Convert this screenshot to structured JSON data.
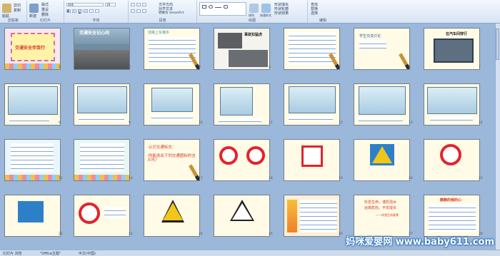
{
  "ribbon": {
    "groups": [
      {
        "id": "clipboard",
        "label": "剪贴板",
        "buttons": [
          "剪切",
          "复制",
          "粘贴"
        ]
      },
      {
        "id": "slides",
        "label": "幻灯片",
        "buttons": [
          "新建",
          "版式",
          "重设",
          "删除"
        ]
      },
      {
        "id": "font",
        "label": "字体",
        "buttons": [
          "宋体",
          "18",
          "B",
          "I",
          "U"
        ]
      },
      {
        "id": "paragraph",
        "label": "段落",
        "buttons": [
          "文字方向",
          "对齐文本",
          "转换为 SmartArt"
        ]
      },
      {
        "id": "drawing",
        "label": "绘图",
        "buttons": [
          "排列",
          "快速样式",
          "形状填充",
          "形状轮廓",
          "形状效果"
        ]
      },
      {
        "id": "editing",
        "label": "编辑",
        "buttons": [
          "查找",
          "替换",
          "选择"
        ]
      }
    ]
  },
  "slides": [
    {
      "n": "1",
      "title": "交通安全伴我行"
    },
    {
      "n": "2",
      "title": "交通安全记心间"
    },
    {
      "n": "3",
      "title": "道路上车辆多"
    },
    {
      "n": "4",
      "title": "事故扣猛虎"
    },
    {
      "n": "5",
      "title": ""
    },
    {
      "n": "6",
      "title": "学生交流讨论"
    },
    {
      "n": "7",
      "title": "在汽车间穿行"
    },
    {
      "n": "8",
      "title": ""
    },
    {
      "n": "9",
      "title": ""
    },
    {
      "n": "10",
      "title": ""
    },
    {
      "n": "11",
      "title": ""
    },
    {
      "n": "12",
      "title": ""
    },
    {
      "n": "13",
      "title": ""
    },
    {
      "n": "14",
      "title": ""
    },
    {
      "n": "15",
      "title": ""
    },
    {
      "n": "16",
      "title": ""
    },
    {
      "n": "17",
      "title": "认识交通标志"
    },
    {
      "n": "18",
      "title": ""
    },
    {
      "n": "19",
      "title": ""
    },
    {
      "n": "20",
      "title": ""
    },
    {
      "n": "21",
      "title": ""
    },
    {
      "n": "22",
      "title": ""
    },
    {
      "n": "23",
      "title": ""
    },
    {
      "n": "24",
      "title": ""
    },
    {
      "n": "25",
      "title": ""
    },
    {
      "n": "26",
      "title": ""
    },
    {
      "n": "27",
      "title": "珍爱生命"
    },
    {
      "n": "28",
      "title": "静静的我的心"
    }
  ],
  "slide17": {
    "line1": "·认识交通标志：",
    "line2": "·你能说出下列交通图标的含义吗？"
  },
  "slide27": {
    "line1": "珍爱生命，谨防溺水",
    "line2": "远离危险，平安成长",
    "line3": "——伴我生命要素"
  },
  "status": {
    "tab": "幻灯片 浏览",
    "theme": "\"Office主题\"",
    "lang": "中文(中国)"
  },
  "watermark": "妈咪爱婴网 www.baby611.com"
}
